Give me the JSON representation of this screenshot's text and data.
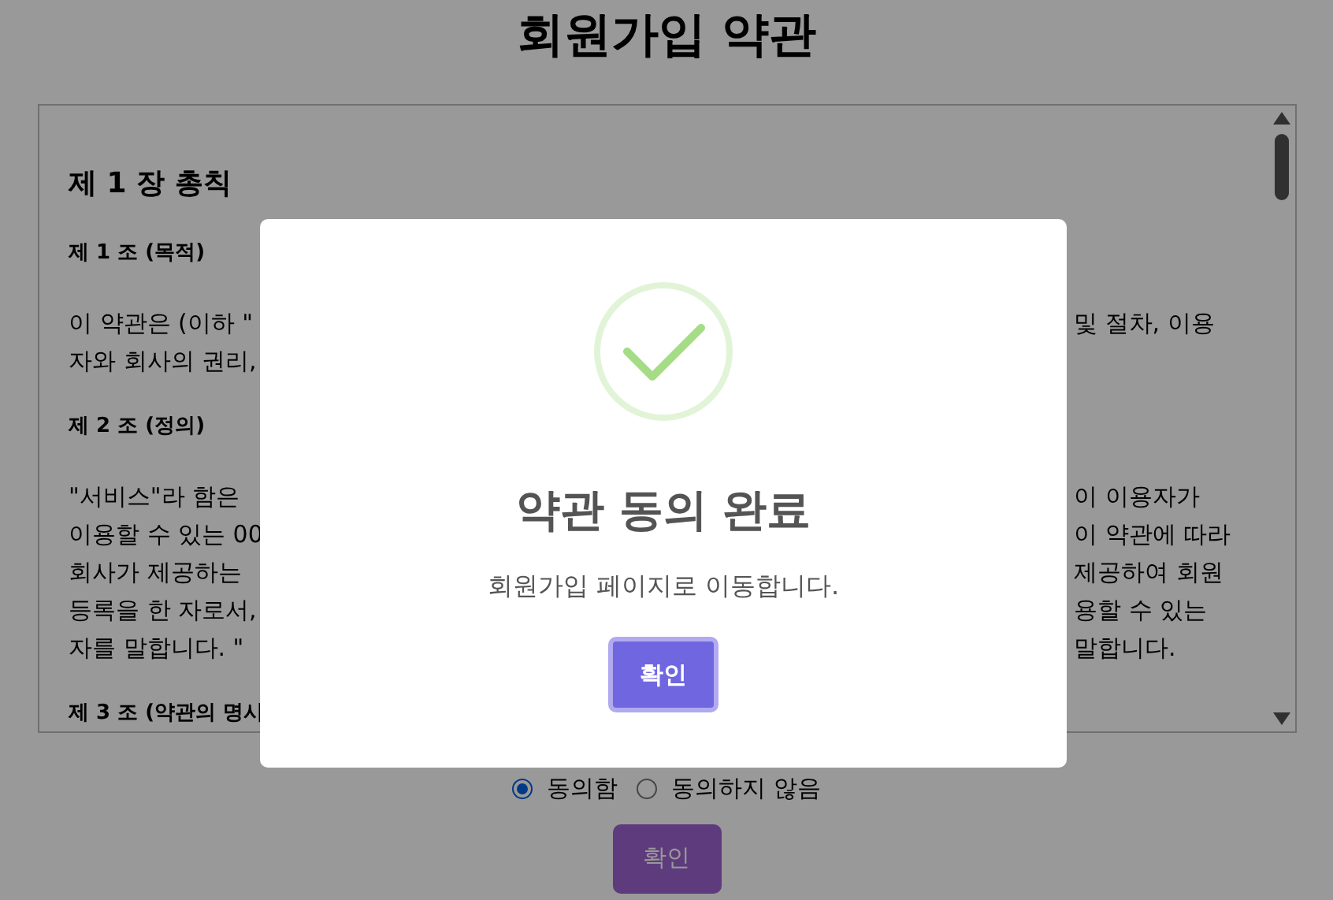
{
  "page_title": "회원가입 약관",
  "terms": {
    "heading": "제 1 장 총칙",
    "blocks": [
      {
        "kind": "article",
        "text": "제 1 조 (목적)"
      },
      {
        "kind": "paragraph",
        "lines": [
          {
            "left": "이 약관은 (이하 \"",
            "right": "및 절차, 이용"
          },
          {
            "left": "자와 회사의 권리,"
          }
        ]
      },
      {
        "kind": "article",
        "text": "제 2 조 (정의)"
      },
      {
        "kind": "paragraph",
        "lines": [
          {
            "left": "\"서비스\"라 함은",
            "right": "이 이용자가"
          },
          {
            "left": "이용할 수 있는 00",
            "right": "이 약관에 따라"
          },
          {
            "left": "회사가 제공하는",
            "right": "제공하여 회원"
          },
          {
            "left": "등록을 한 자로서,",
            "right": "용할 수 있는"
          },
          {
            "left": "자를 말합니다. \"",
            "right": "말합니다."
          }
        ]
      },
      {
        "kind": "article",
        "text": "제 3 조 (약관의 명시"
      }
    ]
  },
  "agreement": [
    {
      "label": "동의함",
      "selected": true
    },
    {
      "label": "동의하지 않음",
      "selected": false
    }
  ],
  "submit_button": "확인",
  "dialog": {
    "title": "약관 동의 완료",
    "message": "회원가입 페이지로 이동합니다.",
    "confirm_button": "확인"
  }
}
